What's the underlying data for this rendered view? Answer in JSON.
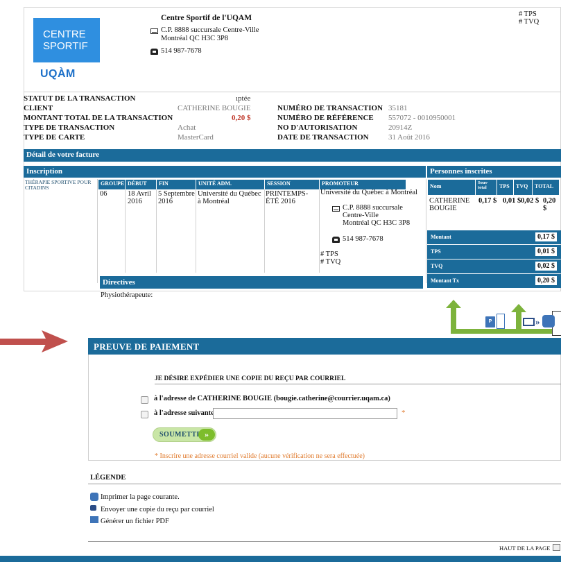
{
  "header": {
    "org_name": "Centre Sportif de l'UQAM",
    "address_line1": "C.P. 8888 succursale Centre-Ville",
    "address_line2": "Montréal QC  H3C 3P8",
    "phone": "514 987-7678",
    "tax_tps": "# TPS",
    "tax_tvq": "# TVQ",
    "logo_line1": "CENTRE",
    "logo_line2": "SPORTIF",
    "logo_brand": "UQÀM"
  },
  "transaction": {
    "status_label": "STATUT DE LA TRANSACTION",
    "status_value": "ıptée",
    "client_label": "CLIENT",
    "client_value": "CATHERINE BOUGIE",
    "total_label": "MONTANT TOTAL DE LA TRANSACTION",
    "total_value": "0,20 $",
    "type_label": "TYPE DE TRANSACTION",
    "type_value": "Achat",
    "card_label": "TYPE DE CARTE",
    "card_value": "MasterCard",
    "number_label": "NUMÉRO DE TRANSACTION",
    "number_value": "35181",
    "reference_label": "NUMÉRO DE RÉFÉRENCE",
    "reference_value": "557072 - 0010950001",
    "auth_label": "NO D'AUTORISATION",
    "auth_value": "20914Z",
    "date_label": "DATE DE TRANSACTION",
    "date_value": "31 Août 2016"
  },
  "invoice": {
    "detail_title": "Détail de votre facture",
    "inscription_title": "Inscription",
    "registrants_title": "Personnes inscrites",
    "activity": "THÉRAPIE SPORTIVE POUR CITADINS",
    "columns": [
      "GROUPE",
      "DÉBUT",
      "FIN",
      "UNITÉ ADM.",
      "SESSION",
      "PROMOTEUR"
    ],
    "row": {
      "groupe": "06",
      "debut": "18 Avril 2016",
      "fin": "5 Septembre 2016",
      "unite": "Université du Québec à Montréal",
      "session": "PRINTEMPS-ÉTÉ 2016",
      "promoteur": "Université du Québec à Montréal",
      "promo_address1": "C.P. 8888 succursale Centre-Ville",
      "promo_address2": "Montréal QC  H3C 3P8",
      "promo_phone": "514 987-7678",
      "promo_tps": "# TPS",
      "promo_tvq": "# TVQ"
    },
    "directives_title": "Directives",
    "directives_text": "Physiothérapeute:",
    "registrant_columns": [
      "Nom",
      "Sous-total",
      "TPS",
      "TVQ",
      "TOTAL"
    ],
    "registrant": {
      "name": "CATHERINE BOUGIE",
      "subtotal": "0,17 $",
      "tps": "0,01 $",
      "tvq": "0,02 $",
      "total": "0,20 $"
    },
    "summary": [
      {
        "label": "Montant",
        "value": "0,17 $"
      },
      {
        "label": "TPS",
        "value": "0,01 $"
      },
      {
        "label": "TVQ",
        "value": "0,02 $"
      },
      {
        "label": "Montant Tx",
        "value": "0,20 $"
      }
    ]
  },
  "proof": {
    "title": "PREUVE DE PAIEMENT",
    "email_heading": "JE DÉSIRE EXPÉDIER UNE COPIE DU REÇU PAR COURRIEL",
    "option1": "à l'adresse de CATHERINE BOUGIE (bougie.catherine@courrier.uqam.ca)",
    "option2": "à l'adresse suivante",
    "email_value": "",
    "required_mark": "*",
    "submit_label": "SOUMETTRE",
    "note": "* Inscrire une adresse courriel valide (aucune vérification ne sera effectuée)"
  },
  "legend": {
    "title": "LÉGENDE",
    "items": [
      "Imprimer la page courante.",
      "Envoyer une copie du reçu par courriel",
      "Générer un fichier PDF"
    ],
    "back_to_top": "HAUT DE LA PAGE"
  },
  "colors": {
    "header_blue": "#1b6b9a",
    "logo_blue": "#2f8fe0",
    "callout_green": "#7db33c",
    "arrow_red": "#c0504d"
  }
}
